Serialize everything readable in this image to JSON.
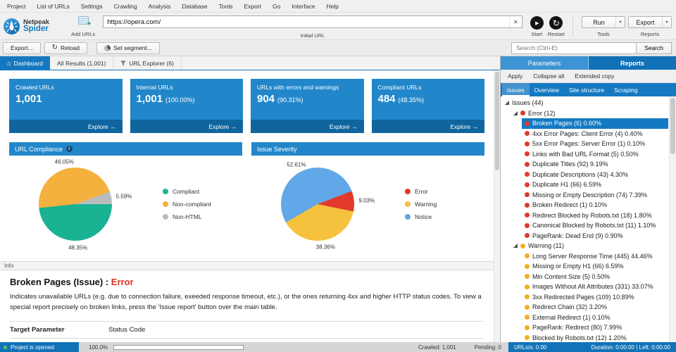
{
  "menu": {
    "items": [
      "Project",
      "List of URLs",
      "Settings",
      "Crawling",
      "Analysis",
      "Database",
      "Tools",
      "Export",
      "Go",
      "Interface",
      "Help"
    ]
  },
  "toolbar": {
    "brand_line1": "Netpeak",
    "brand_line2": "Spider",
    "add_urls_label": "Add URLs",
    "url_value": "https://opera.com/",
    "url_caption": "Initial URL",
    "start_label": "Start",
    "restart_label": "Restart",
    "run_label": "Run",
    "export_label": "Export",
    "tools_caption": "Tools",
    "reports_caption": "Reports"
  },
  "actionbar": {
    "export_button": "Export...",
    "reload_button": "Reload",
    "set_segment_button": "Set segment...",
    "search_placeholder": "Search (Ctrl+E)",
    "search_button": "Search"
  },
  "result_tabs": [
    {
      "label": "Dashboard",
      "icon": "home",
      "active": true
    },
    {
      "label": "All Results (1,001)",
      "icon": null,
      "active": false
    },
    {
      "label": "URL Explorer (6)",
      "icon": "funnel",
      "active": false
    }
  ],
  "cards": [
    {
      "title": "Crawled URLs",
      "value": "1,001",
      "pct": "",
      "explore_label": "Explore →"
    },
    {
      "title": "Internal URLs",
      "value": "1,001",
      "pct": "(100.00%)",
      "explore_label": "Explore →"
    },
    {
      "title": "URLs with errors and warnings",
      "value": "904",
      "pct": "(90.31%)",
      "explore_label": "Explore →"
    },
    {
      "title": "Compliant URLs",
      "value": "484",
      "pct": "(48.35%)",
      "explore_label": "Explore →"
    }
  ],
  "chart_data": [
    {
      "type": "pie",
      "title": "URL Compliance",
      "info_icon": true,
      "legend_position": "right",
      "slices": [
        {
          "label": "Compliant",
          "value": 48.35,
          "pct_label": "48.35%",
          "color": "#19b394",
          "start_deg": 90,
          "end_deg": 264
        },
        {
          "label": "Non-compliant",
          "value": 46.05,
          "pct_label": "46.05%",
          "color": "#f4b13e",
          "start_deg": 264,
          "end_deg": 430
        },
        {
          "label": "Non-HTML",
          "value": 5.59,
          "pct_label": "5.59%",
          "color": "#b9bcbd",
          "start_deg": 70,
          "end_deg": 90
        }
      ]
    },
    {
      "type": "pie",
      "title": "Issue Severity",
      "info_icon": false,
      "legend_position": "right",
      "slices": [
        {
          "label": "Error",
          "value": 9.03,
          "pct_label": "9.03%",
          "color": "#e2392c",
          "start_deg": 69,
          "end_deg": 101.5
        },
        {
          "label": "Warning",
          "value": 38.36,
          "pct_label": "38.36%",
          "color": "#f6c13d",
          "start_deg": 101.5,
          "end_deg": 240
        },
        {
          "label": "Notice",
          "value": 52.61,
          "pct_label": "52.61%",
          "color": "#62a8e8",
          "start_deg": 240,
          "end_deg": 429
        }
      ]
    }
  ],
  "info": {
    "strip": "Info",
    "title": "Broken Pages (Issue) : ",
    "severity": "Error",
    "description": "Indicates unavailable URLs (e.g. due to connection failure, exeeded response timeout, etc.), or the ones returning 4xx and higher HTTP status codes. To view a special report precisely on broken links, press the 'Issue report' button over the main table.",
    "param_name": "Target Parameter",
    "param_value": "Status Code"
  },
  "panel": {
    "tabs": [
      {
        "label": "Parameters",
        "active": false
      },
      {
        "label": "Reports",
        "active": true
      }
    ],
    "actions": [
      "Apply",
      "Collapse all",
      "Extended copy"
    ],
    "subtabs": [
      {
        "label": "Issues",
        "active": true
      },
      {
        "label": "Overview",
        "active": false
      },
      {
        "label": "Site structure",
        "active": false
      },
      {
        "label": "Scraping",
        "active": false
      }
    ],
    "tree": {
      "root": "Issues (44)",
      "groups": [
        {
          "label": "Error (12)",
          "color": "#e2392c",
          "items": [
            {
              "label": "Broken Pages (6) 0.60%",
              "selected": true
            },
            {
              "label": "4xx Error Pages: Client Error (4) 0.40%",
              "selected": false
            },
            {
              "label": "5xx Error Pages: Server Error (1) 0.10%",
              "selected": false
            },
            {
              "label": "Links with Bad URL Format (5) 0.50%",
              "selected": false
            },
            {
              "label": "Duplicate Titles (92) 9.19%",
              "selected": false
            },
            {
              "label": "Duplicate Descriptions (43) 4.30%",
              "selected": false
            },
            {
              "label": "Duplicate H1 (66) 6.59%",
              "selected": false
            },
            {
              "label": "Missing or Empty Description (74) 7.39%",
              "selected": false
            },
            {
              "label": "Broken Redirect (1) 0.10%",
              "selected": false
            },
            {
              "label": "Redirect Blocked by Robots.txt (18) 1.80%",
              "selected": false
            },
            {
              "label": "Canonical Blocked by Robots.txt (11) 1.10%",
              "selected": false
            },
            {
              "label": "PageRank: Dead End (9) 0.90%",
              "selected": false
            }
          ]
        },
        {
          "label": "Warning (11)",
          "color": "#f2b01e",
          "items": [
            {
              "label": "Long Server Response Time (445) 44.46%",
              "selected": false
            },
            {
              "label": "Missing or Empty H1 (66) 6.59%",
              "selected": false
            },
            {
              "label": "Min Content Size (5) 0.50%",
              "selected": false
            },
            {
              "label": "Images Without Alt Attributes (331) 33.07%",
              "selected": false
            },
            {
              "label": "3xx Redirected Pages (109) 10.89%",
              "selected": false
            },
            {
              "label": "Redirect Chain (32) 3.20%",
              "selected": false
            },
            {
              "label": "External Redirect (1) 0.10%",
              "selected": false
            },
            {
              "label": "PageRank: Redirect (80) 7.99%",
              "selected": false
            },
            {
              "label": "Blocked by Robots.txt (12) 1.20%",
              "selected": false
            }
          ]
        }
      ]
    }
  },
  "statusbar": {
    "project_status": "Project is opened",
    "progress_pct": "100.0%",
    "crawled": "Crawled: 1,001",
    "pending": "Pending: 0",
    "urls_per_s": "URLs/s: 0.00",
    "duration": "Duration: 0:00:00 | Left: 0:00:00"
  },
  "colors": {
    "accent_blue": "#1579c2",
    "card_blue": "#2287ca",
    "card_footer_blue": "#10659f",
    "status_blue": "#1172b8",
    "error_red": "#e2392c",
    "warning_yellow": "#f2b01e",
    "notice_blue": "#62a8e8",
    "compliant_teal": "#19b394"
  }
}
